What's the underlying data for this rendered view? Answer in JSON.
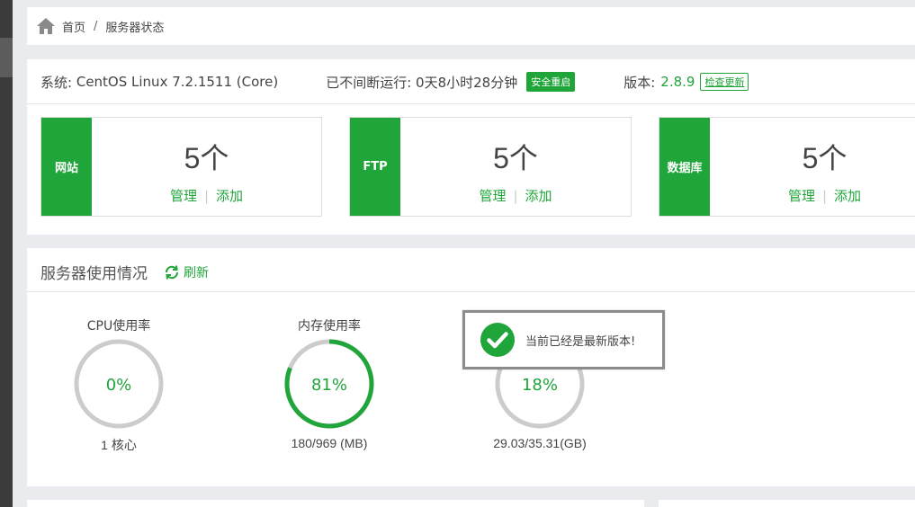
{
  "breadcrumb": {
    "home": "首页",
    "separator": "/",
    "current": "服务器状态"
  },
  "system": {
    "os_label": "系统:",
    "os_value": "CentOS Linux 7.2.1511 (Core)",
    "uptime_label": "已不间断运行:",
    "uptime_value": "0天8小时28分钟",
    "restart_button": "安全重启",
    "version_label": "版本:",
    "version_value": "2.8.9",
    "update_button": "检查更新"
  },
  "cards": [
    {
      "label": "网站",
      "count": "5个",
      "manage": "管理",
      "add": "添加"
    },
    {
      "label": "FTP",
      "count": "5个",
      "manage": "管理",
      "add": "添加"
    },
    {
      "label": "数据库",
      "count": "5个",
      "manage": "管理",
      "add": "添加"
    }
  ],
  "usage": {
    "title": "服务器使用情况",
    "refresh": "刷新",
    "gauges": [
      {
        "title": "CPU使用率",
        "value": "0%",
        "percent": 0,
        "footer": "1 核心"
      },
      {
        "title": "内存使用率",
        "value": "81%",
        "percent": 81,
        "footer": "180/969 (MB)"
      },
      {
        "title": "",
        "value": "18%",
        "percent": 18,
        "footer": "29.03/35.31(GB)"
      }
    ]
  },
  "toast": {
    "message": "当前已经是最新版本!"
  },
  "colors": {
    "accent": "#20a53a",
    "track": "#cccccc"
  }
}
